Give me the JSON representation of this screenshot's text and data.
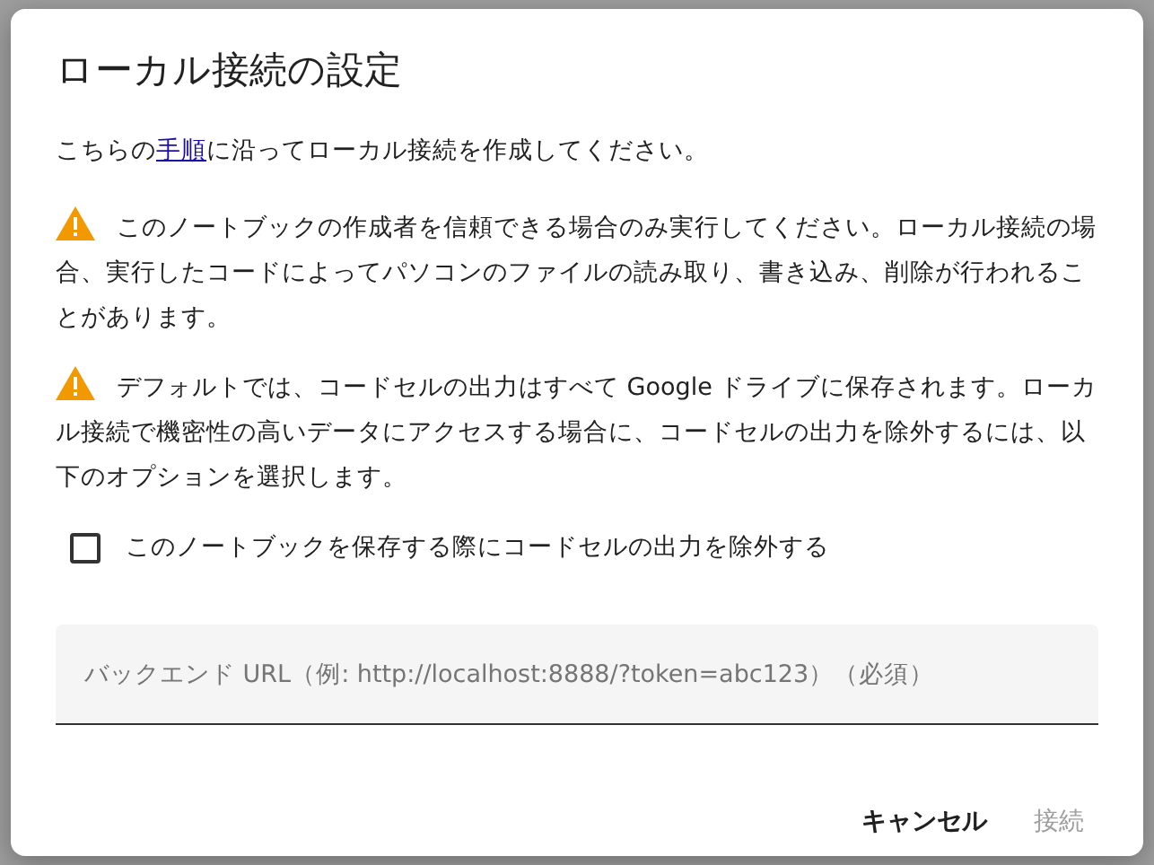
{
  "dialog": {
    "title": "ローカル接続の設定",
    "intro": {
      "before": "こちらの",
      "link": "手順",
      "after": "に沿ってローカル接続を作成してください。"
    },
    "warnings": [
      {
        "text": "このノートブックの作成者を信頼できる場合のみ実行してください。ローカル接続の場合、実行したコードによってパソコンのファイルの読み取り、書き込み、削除が行われることがあります。"
      },
      {
        "text": "デフォルトでは、コードセルの出力はすべて Google ドライブに保存されます。ローカル接続で機密性の高いデータにアクセスする場合に、コードセルの出力を除外するには、以下のオプションを選択します。"
      }
    ],
    "checkbox": {
      "label": "このノートブックを保存する際にコードセルの出力を除外する",
      "checked": false
    },
    "field": {
      "placeholder": "バックエンド URL（例: http://localhost:8888/?token=abc123）（必須）"
    },
    "buttons": [
      {
        "label": "キャンセル",
        "disabled": false
      },
      {
        "label": "接続",
        "disabled": true
      }
    ]
  }
}
